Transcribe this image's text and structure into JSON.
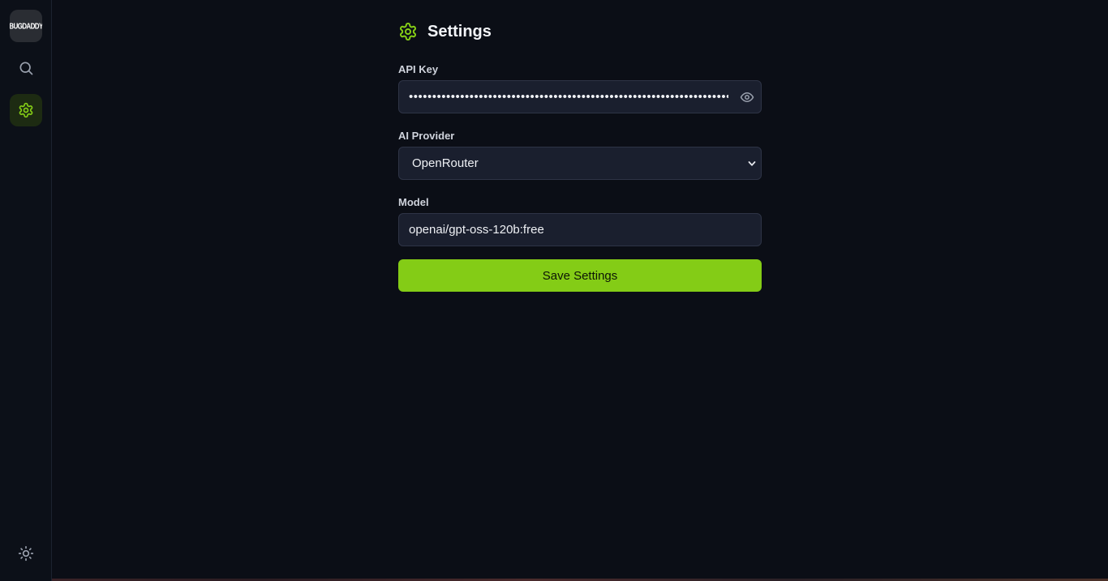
{
  "app": {
    "logo_text": "BUGDADDY"
  },
  "sidebar": {
    "items": [
      {
        "name": "search",
        "icon": "search-icon"
      },
      {
        "name": "settings",
        "icon": "gear-icon",
        "active": true
      },
      {
        "name": "theme",
        "icon": "sun-icon"
      }
    ]
  },
  "page": {
    "title": "Settings",
    "icon": "gear-icon"
  },
  "form": {
    "api_key": {
      "label": "API Key",
      "value": "••••••••••••••••••••••••••••••••••••••••••••••••••••••••••••••••••••••••",
      "toggle_icon": "eye-icon"
    },
    "provider": {
      "label": "AI Provider",
      "selected": "OpenRouter"
    },
    "model": {
      "label": "Model",
      "value": "openai/gpt-oss-120b:free"
    },
    "save_label": "Save Settings"
  },
  "colors": {
    "accent": "#84cc16",
    "background": "#0b0e16",
    "input_bg": "#1a1f2e",
    "active_nav_bg": "#1d2b12"
  }
}
